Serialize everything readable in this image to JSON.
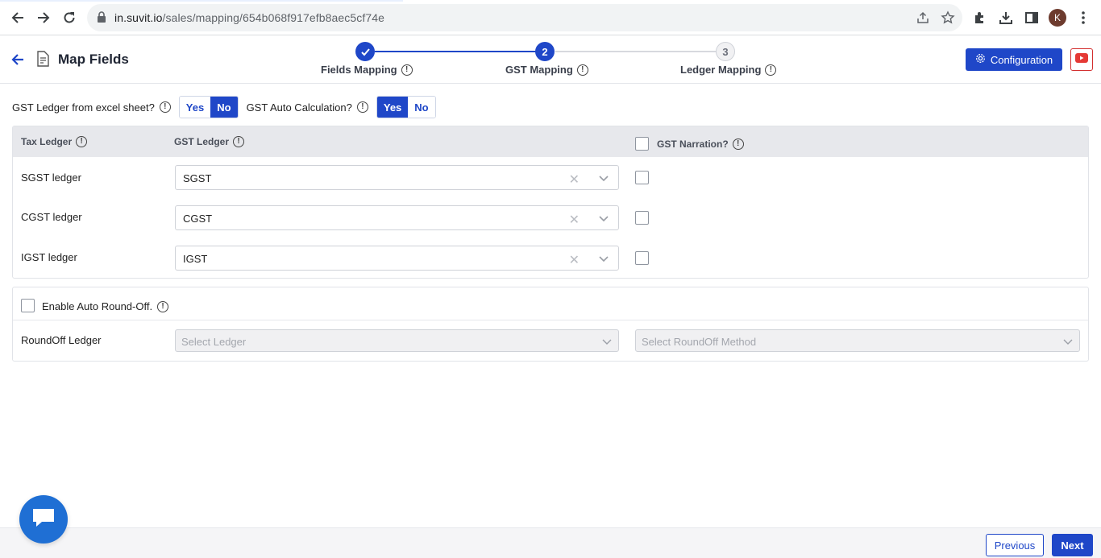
{
  "browser": {
    "url_host": "in.suvit.io",
    "url_path": "/sales/mapping/654b068f917efb8aec5cf74e",
    "avatar_letter": "K"
  },
  "header": {
    "title": "Map Fields",
    "config_label": "Configuration",
    "accent": "#1f47c8"
  },
  "steps": [
    {
      "number": "",
      "label": "Fields Mapping",
      "state": "done"
    },
    {
      "number": "2",
      "label": "GST Mapping",
      "state": "active"
    },
    {
      "number": "3",
      "label": "Ledger Mapping",
      "state": "todo"
    }
  ],
  "toggles": {
    "gst_excel": {
      "label": "GST Ledger from excel sheet?",
      "yes": "Yes",
      "no": "No",
      "selected": "No"
    },
    "gst_auto": {
      "label": "GST Auto Calculation?",
      "yes": "Yes",
      "no": "No",
      "selected": "Yes"
    }
  },
  "table": {
    "col_tax": "Tax Ledger",
    "col_gst": "GST Ledger",
    "col_narration": "GST Narration?",
    "rows": [
      {
        "label": "SGST ledger",
        "value": "SGST"
      },
      {
        "label": "CGST ledger",
        "value": "CGST"
      },
      {
        "label": "IGST ledger",
        "value": "IGST"
      }
    ]
  },
  "roundoff": {
    "enable_label": "Enable Auto Round-Off.",
    "ledger_label": "RoundOff Ledger",
    "ledger_placeholder": "Select Ledger",
    "method_placeholder": "Select RoundOff Method"
  },
  "footer": {
    "previous": "Previous",
    "next": "Next"
  }
}
